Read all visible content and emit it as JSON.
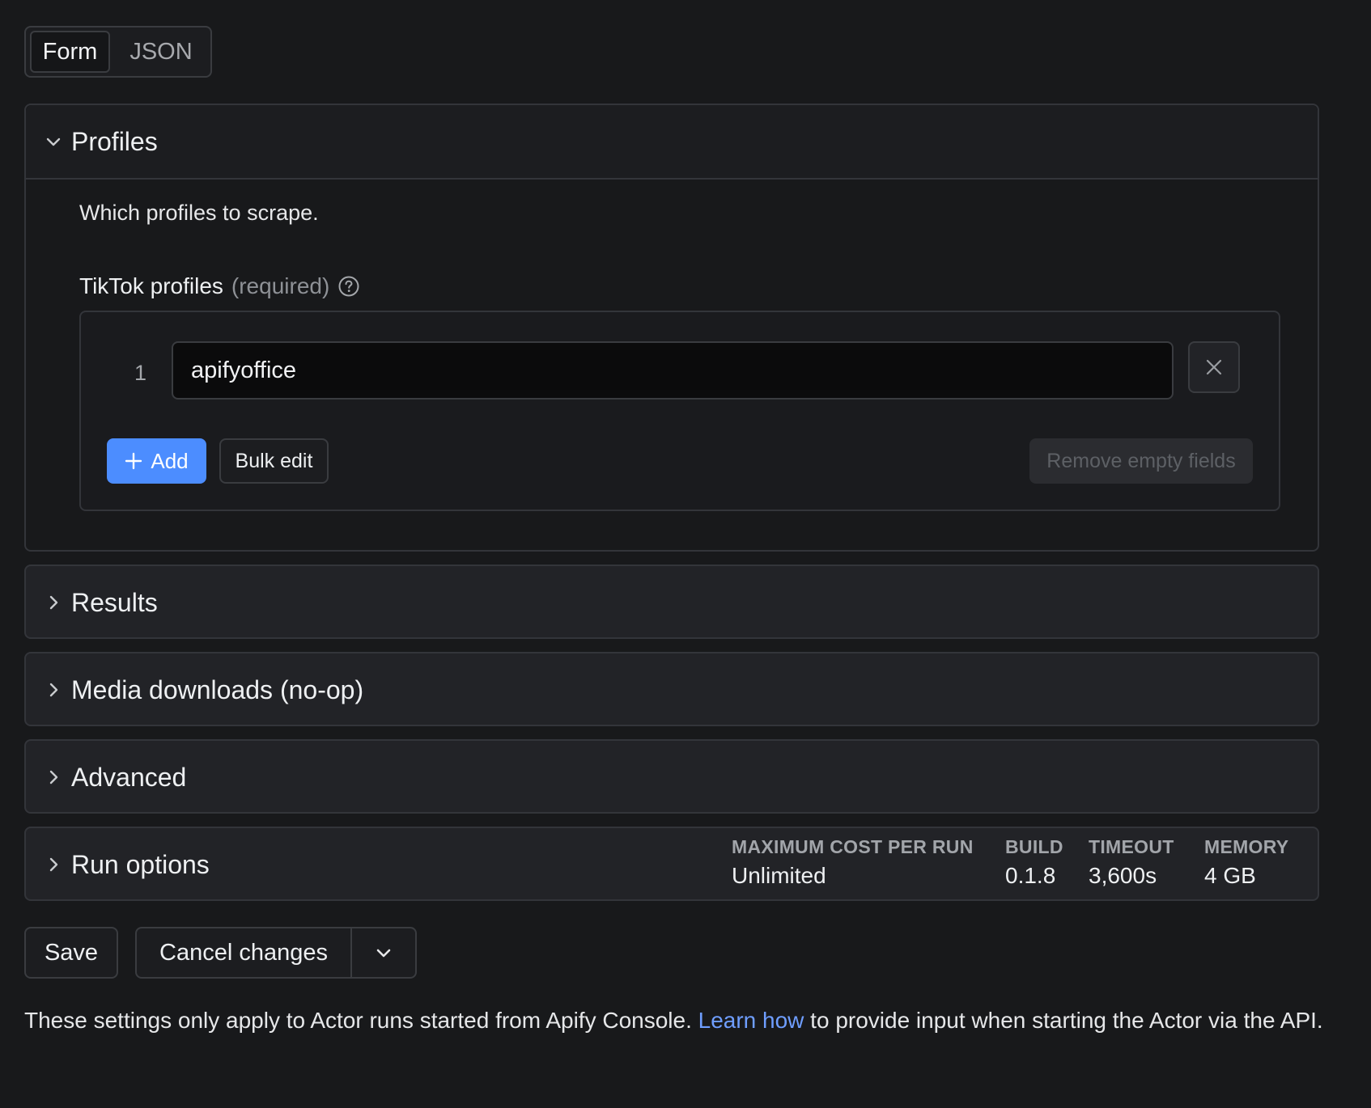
{
  "mode_toggle": {
    "form_label": "Form",
    "json_label": "JSON",
    "active": "Form"
  },
  "profiles_section": {
    "title": "Profiles",
    "description": "Which profiles to scrape.",
    "field_label": "TikTok profiles",
    "field_required": "(required)",
    "items": [
      {
        "index": "1",
        "value": "apifyoffice"
      }
    ],
    "add_label": "Add",
    "bulk_edit_label": "Bulk edit",
    "remove_empty_label": "Remove empty fields"
  },
  "sections": {
    "results": "Results",
    "media": "Media downloads (no-op)",
    "advanced": "Advanced",
    "run_options": "Run options"
  },
  "run_stats": {
    "max_cost_label": "MAXIMUM COST PER RUN",
    "max_cost_value": "Unlimited",
    "build_label": "BUILD",
    "build_value": "0.1.8",
    "timeout_label": "TIMEOUT",
    "timeout_value": "3,600s",
    "memory_label": "MEMORY",
    "memory_value": "4 GB"
  },
  "actions": {
    "save_label": "Save",
    "cancel_label": "Cancel changes"
  },
  "footer": {
    "text_before": "These settings only apply to Actor runs started from Apify Console. ",
    "link_text": "Learn how",
    "text_after": " to provide input when starting the Actor via the API."
  },
  "colors": {
    "accent": "#4c8dff",
    "link": "#6f9eff",
    "background": "#18191b"
  }
}
